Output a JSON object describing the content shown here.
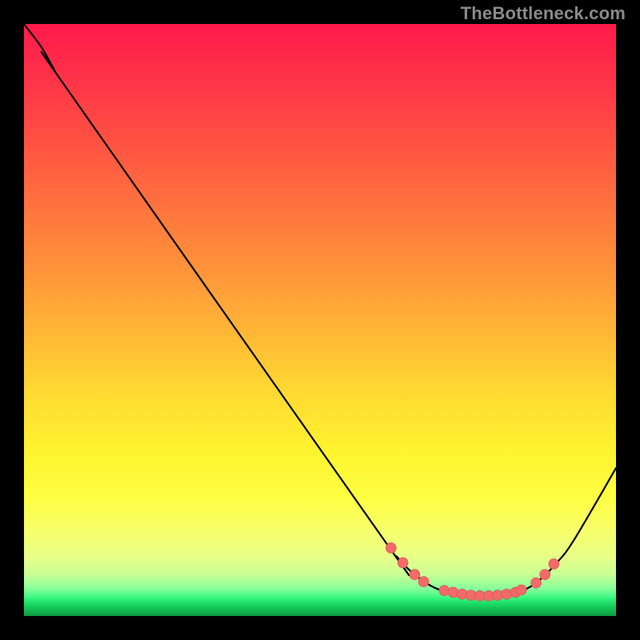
{
  "attribution": "TheBottleneck.com",
  "chart_data": {
    "type": "line",
    "title": "",
    "xlabel": "",
    "ylabel": "",
    "xlim": [
      0,
      100
    ],
    "ylim": [
      0,
      100
    ],
    "grid": false,
    "legend": false,
    "curve": [
      {
        "x": 0,
        "y": 100
      },
      {
        "x": 3,
        "y": 96
      },
      {
        "x": 5,
        "y": 92.5
      },
      {
        "x": 8,
        "y": 88
      },
      {
        "x": 60,
        "y": 14
      },
      {
        "x": 63,
        "y": 10
      },
      {
        "x": 66,
        "y": 7
      },
      {
        "x": 70,
        "y": 4.5
      },
      {
        "x": 75,
        "y": 3.5
      },
      {
        "x": 80,
        "y": 3.4
      },
      {
        "x": 84,
        "y": 4.2
      },
      {
        "x": 87,
        "y": 6
      },
      {
        "x": 90,
        "y": 9
      },
      {
        "x": 93,
        "y": 13
      },
      {
        "x": 100,
        "y": 25
      }
    ],
    "markers": [
      {
        "x": 62,
        "y": 11.5
      },
      {
        "x": 64,
        "y": 9
      },
      {
        "x": 66,
        "y": 7
      },
      {
        "x": 67.5,
        "y": 5.8
      },
      {
        "x": 71,
        "y": 4.3
      },
      {
        "x": 72.5,
        "y": 4
      },
      {
        "x": 74,
        "y": 3.7
      },
      {
        "x": 75.5,
        "y": 3.5
      },
      {
        "x": 77,
        "y": 3.4
      },
      {
        "x": 78.5,
        "y": 3.4
      },
      {
        "x": 80,
        "y": 3.5
      },
      {
        "x": 81.5,
        "y": 3.7
      },
      {
        "x": 83,
        "y": 4
      },
      {
        "x": 84,
        "y": 4.4
      },
      {
        "x": 86.5,
        "y": 5.6
      },
      {
        "x": 88,
        "y": 7
      },
      {
        "x": 89.5,
        "y": 8.8
      }
    ]
  }
}
